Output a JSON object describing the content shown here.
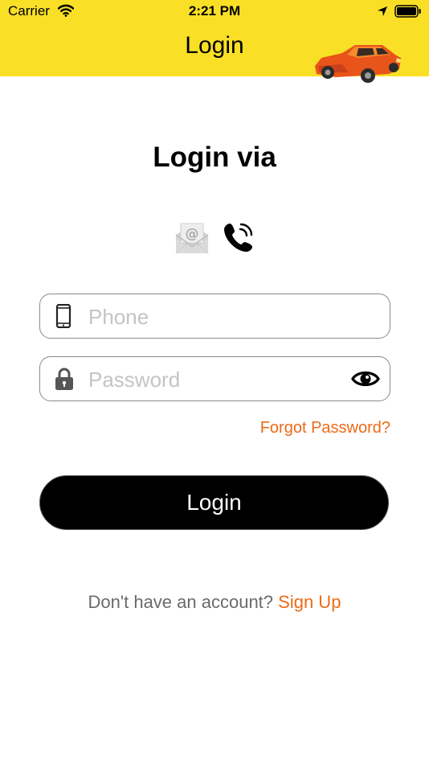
{
  "status_bar": {
    "carrier": "Carrier",
    "time": "2:21 PM",
    "icons": [
      "wifi-icon",
      "location-arrow-icon",
      "battery-icon"
    ]
  },
  "nav": {
    "title": "Login",
    "logo_icon": "orange-car-icon"
  },
  "heading": "Login via",
  "login_methods": [
    {
      "icon": "email-icon",
      "state": "inactive"
    },
    {
      "icon": "phone-call-icon",
      "state": "active"
    }
  ],
  "phone_field": {
    "icon": "mobile-phone-icon",
    "placeholder": "Phone",
    "value": ""
  },
  "password_field": {
    "icon": "lock-icon",
    "placeholder": "Password",
    "value": "",
    "toggle_icon": "eye-icon"
  },
  "forgot_password": "Forgot Password?",
  "login_button": "Login",
  "signup": {
    "prompt": "Don't have an account?",
    "link": "Sign Up"
  },
  "colors": {
    "header_bg": "#f9df26",
    "accent": "#ec6a18",
    "button_bg": "#000000"
  }
}
